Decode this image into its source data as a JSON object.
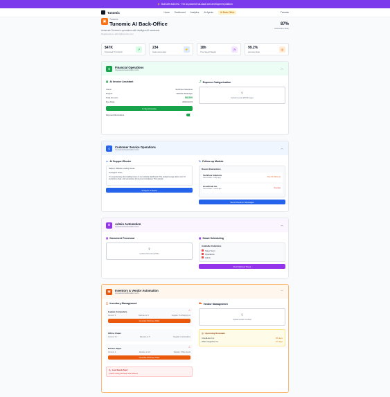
{
  "banner": {
    "text": "Built with Bolt.new · The AI-powered full-stack web development platform"
  },
  "nav": {
    "brand": "Tunomic",
    "links": [
      "Home",
      "Dashboard",
      "Analytics",
      "AI Agents",
      "AI Back-Office"
    ],
    "user": "Tunomic"
  },
  "header": {
    "subtitle": "Tunomic",
    "title": "Tunomic AI Back-Office",
    "description": "Automate Tunomic's operations with intelligent AI assistants",
    "registered": "Registered as: admin@tunomic.com",
    "rate": "87%",
    "rate_label": "Automation Rate"
  },
  "stats": [
    {
      "value": "$47K",
      "label": "Processed This Month",
      "icon": "↗",
      "bg": "#dcfce7",
      "fg": "#16a34a"
    },
    {
      "value": "234",
      "label": "Tasks Automated",
      "icon": "⚡",
      "bg": "#dbeafe",
      "fg": "#2563eb"
    },
    {
      "value": "18h",
      "label": "Time Saved Weekly",
      "icon": "◷",
      "bg": "#f3e8ff",
      "fg": "#9333ea"
    },
    {
      "value": "99.2%",
      "label": "Accuracy Rate",
      "icon": "◎",
      "bg": "#ffedd5",
      "fg": "#ea580c"
    }
  ],
  "financial": {
    "title": "Financial Operations",
    "subtitle": "AI-powered automation tools",
    "invoice": {
      "title": "AI Invoice Assistant",
      "rows": [
        [
          "Client:",
          "TechFlow Solutions"
        ],
        [
          "Project:",
          "Website Redesign"
        ],
        [
          "Total Amount:",
          "$8,500"
        ],
        [
          "Due Date:",
          "2024-02-15"
        ]
      ],
      "button": "Send Invoice",
      "reminders": "Payment Reminders"
    },
    "expense": {
      "title": "Expense Categorization",
      "upload": "Upload receipt (PDF/Image)"
    }
  },
  "customer": {
    "title": "Customer Service Operations",
    "subtitle": "AI-powered automation tools",
    "router": {
      "title": "AI Support Router",
      "lines": [
        "Subject: Website Loading Issues",
        "Hi Support Team,",
        "I'm experiencing slow loading times on our website dashboard. The analytics page takes over 10 seconds to load, and sometimes it times out completely. This started"
      ],
      "button": "Analyze & Route"
    },
    "followup": {
      "title": "Follow-up Module",
      "heading": "Recent Interactions",
      "items": [
        {
          "name": "TechFlow Solutions",
          "time": "Last contact: 3 days ago",
          "action": "Due for follow-up"
        },
        {
          "name": "GrowthLab Inc.",
          "time": "Last contact: 1 week ago",
          "action": "Overdue"
        }
      ],
      "button": "Send Check-in Messages"
    }
  },
  "admin": {
    "title": "Admin Automation",
    "subtitle": "AI-powered automation tools",
    "doc": {
      "title": "Document Processor",
      "upload": "Upload document (PDF)"
    },
    "sched": {
      "title": "Smart Scheduling",
      "heading": "Available Calendars",
      "items": [
        "Sales Team",
        "Operations",
        "Admin"
      ],
      "button": "Find Optimal Times"
    }
  },
  "inventory": {
    "title": "Inventory & Vendor Automation",
    "subtitle": "AI-powered automation tools",
    "mgmt": {
      "title": "Inventory Management",
      "items": [
        {
          "name": "Laptop Computers",
          "current": "Current: 5",
          "reorder": "Reorder at: 8",
          "supplier": "Supplier: TechSupply Co",
          "button": "Generate Purchase Order"
        },
        {
          "name": "Office Chairs",
          "current": "Current: 15",
          "reorder": "Reorder at: 5",
          "supplier": "Supplier: FurnitureRus",
          "button": ""
        },
        {
          "name": "Printer Paper",
          "current": "Current: 3",
          "reorder": "Reorder at: 20",
          "supplier": "Supplier: Office Depot",
          "button": "Generate Purchase Order"
        }
      ],
      "alert_title": "Low Stock Alert",
      "alert_text": "2 items need purchase order placed"
    },
    "vendor": {
      "title": "Vendor Management",
      "upload": "Upload vendor contract",
      "renewals_title": "Upcoming Renewals",
      "renewals": [
        [
          "CloudHost Inc.",
          "45 days"
        ],
        [
          "Office Supplies Co.",
          "67 days"
        ]
      ]
    }
  }
}
